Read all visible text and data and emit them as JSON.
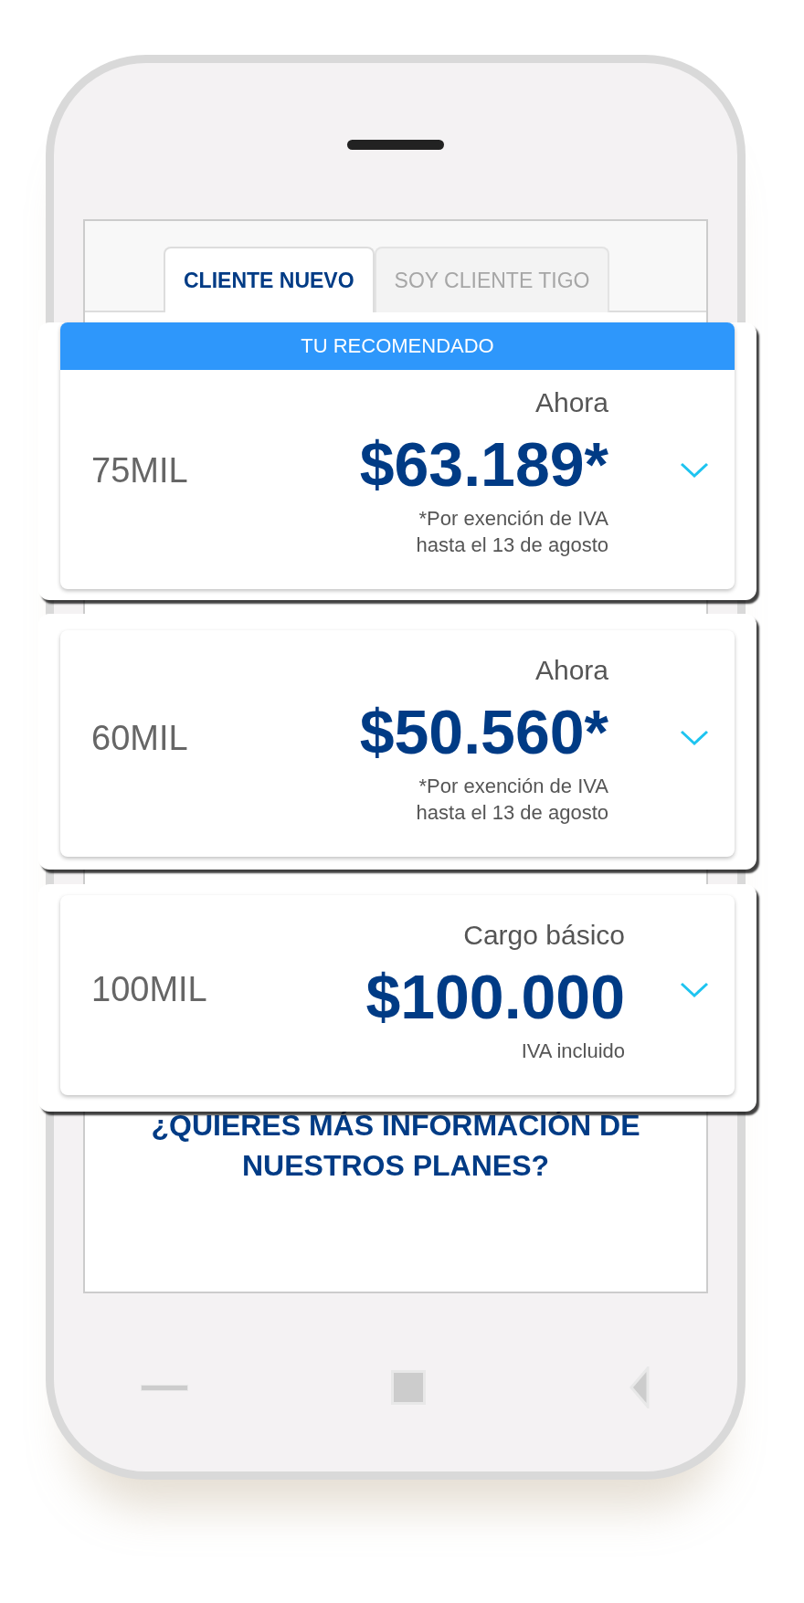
{
  "tabs": [
    {
      "label": "CLIENTE NUEVO",
      "selected": true
    },
    {
      "label": "SOY CLIENTE TIGO",
      "selected": false
    }
  ],
  "plans": [
    {
      "banner": "TU RECOMENDADO",
      "name": "75MIL",
      "caption": "Ahora",
      "price": "$63.189*",
      "note_lines": [
        "*Por exención de IVA",
        "hasta el 13 de agosto"
      ]
    },
    {
      "name": "60MIL",
      "caption": "Ahora",
      "price": "$50.560*",
      "note_lines": [
        "*Por exención de IVA",
        "hasta el 13 de agosto"
      ]
    },
    {
      "name": "100MIL",
      "caption": "Cargo básico",
      "price": "$100.000",
      "note_lines": [
        "IVA incluido"
      ]
    }
  ],
  "heading": "¿QUIERES MÁS INFORMACIÓN DE NUESTROS PLANES?"
}
